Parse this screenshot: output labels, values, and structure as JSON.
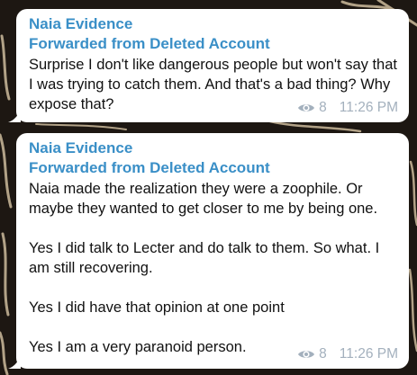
{
  "colors": {
    "background": "#1d1712",
    "accent": "#3a8fc7",
    "meta": "#a3b0bd"
  },
  "messages": [
    {
      "sender": "Naia Evidence",
      "forwarded": "Forwarded from Deleted Account",
      "text": "Surprise I don't like dangerous people but won't say that I was trying to catch them. And that's a bad thing? Why expose that?",
      "views_icon": "eye-icon",
      "views": "8",
      "time": "11:26 PM"
    },
    {
      "sender": "Naia Evidence",
      "forwarded": "Forwarded from Deleted Account",
      "text": "Naia made the realization they were a zoophile. Or maybe they wanted to get closer to me by being one.\n\nYes I did talk to Lecter and do talk to them. So what. I am still recovering.\n\nYes I did have that opinion at one point\n\nYes I am a very paranoid person.",
      "views_icon": "eye-icon",
      "views": "8",
      "time": "11:26 PM"
    }
  ]
}
